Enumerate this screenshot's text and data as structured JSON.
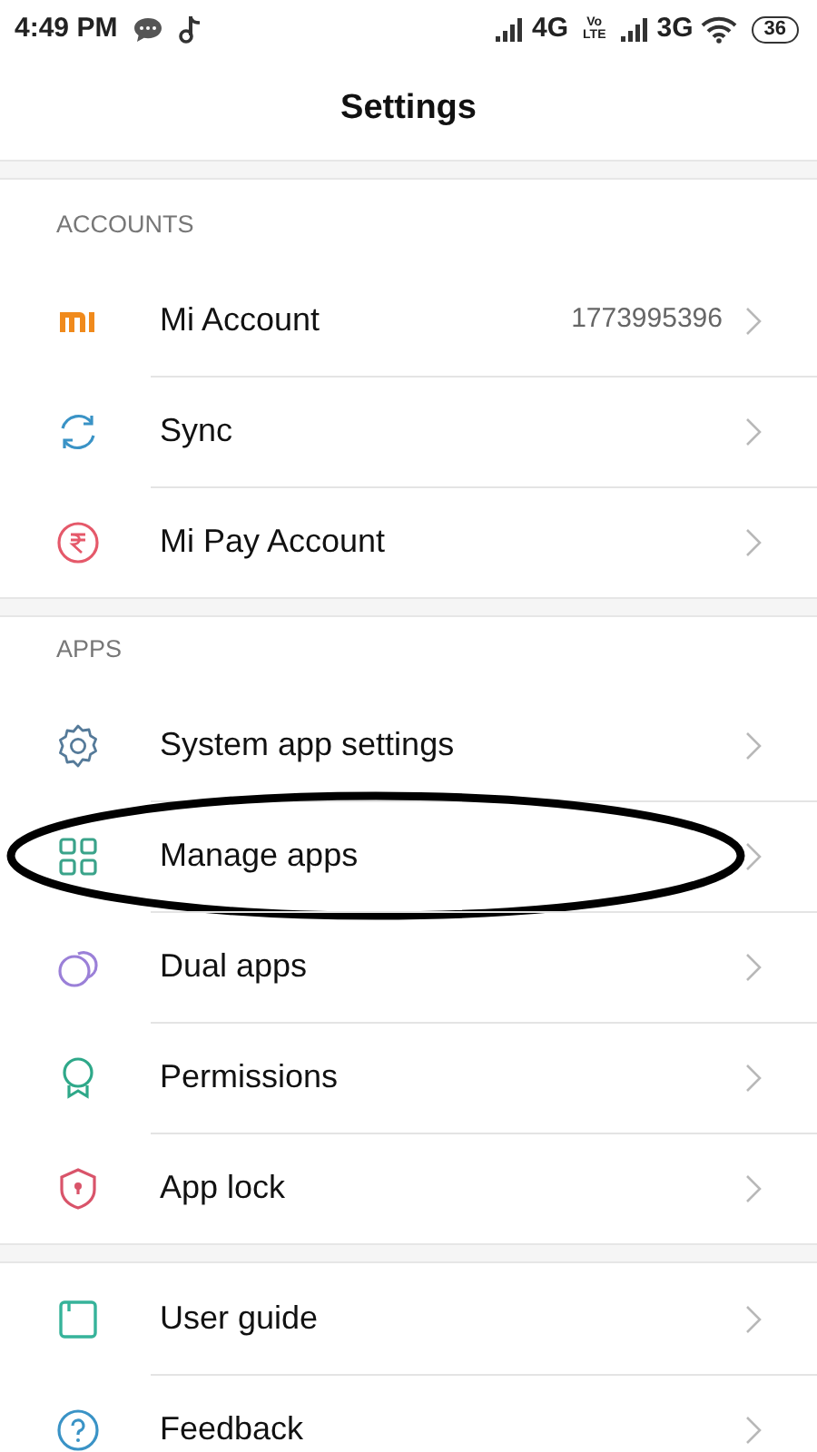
{
  "status_bar": {
    "time": "4:49 PM",
    "network_1": "4G",
    "volte_top": "Vo",
    "volte_bottom": "LTE",
    "network_2": "3G",
    "battery": "36"
  },
  "title": "Settings",
  "sections": [
    {
      "header": "ACCOUNTS",
      "items": [
        {
          "label": "Mi Account",
          "value": "1773995396",
          "circled": false
        },
        {
          "label": "Sync",
          "circled": false
        },
        {
          "label": "Mi Pay Account",
          "circled": false
        }
      ]
    },
    {
      "header": "APPS",
      "items": [
        {
          "label": "System app settings",
          "circled": false
        },
        {
          "label": "Manage apps",
          "circled": true
        },
        {
          "label": "Dual apps",
          "circled": false
        },
        {
          "label": "Permissions",
          "circled": false
        },
        {
          "label": "App lock",
          "circled": false
        }
      ]
    },
    {
      "items": [
        {
          "label": "User guide",
          "circled": false
        },
        {
          "label": "Feedback",
          "circled": false
        }
      ]
    }
  ]
}
